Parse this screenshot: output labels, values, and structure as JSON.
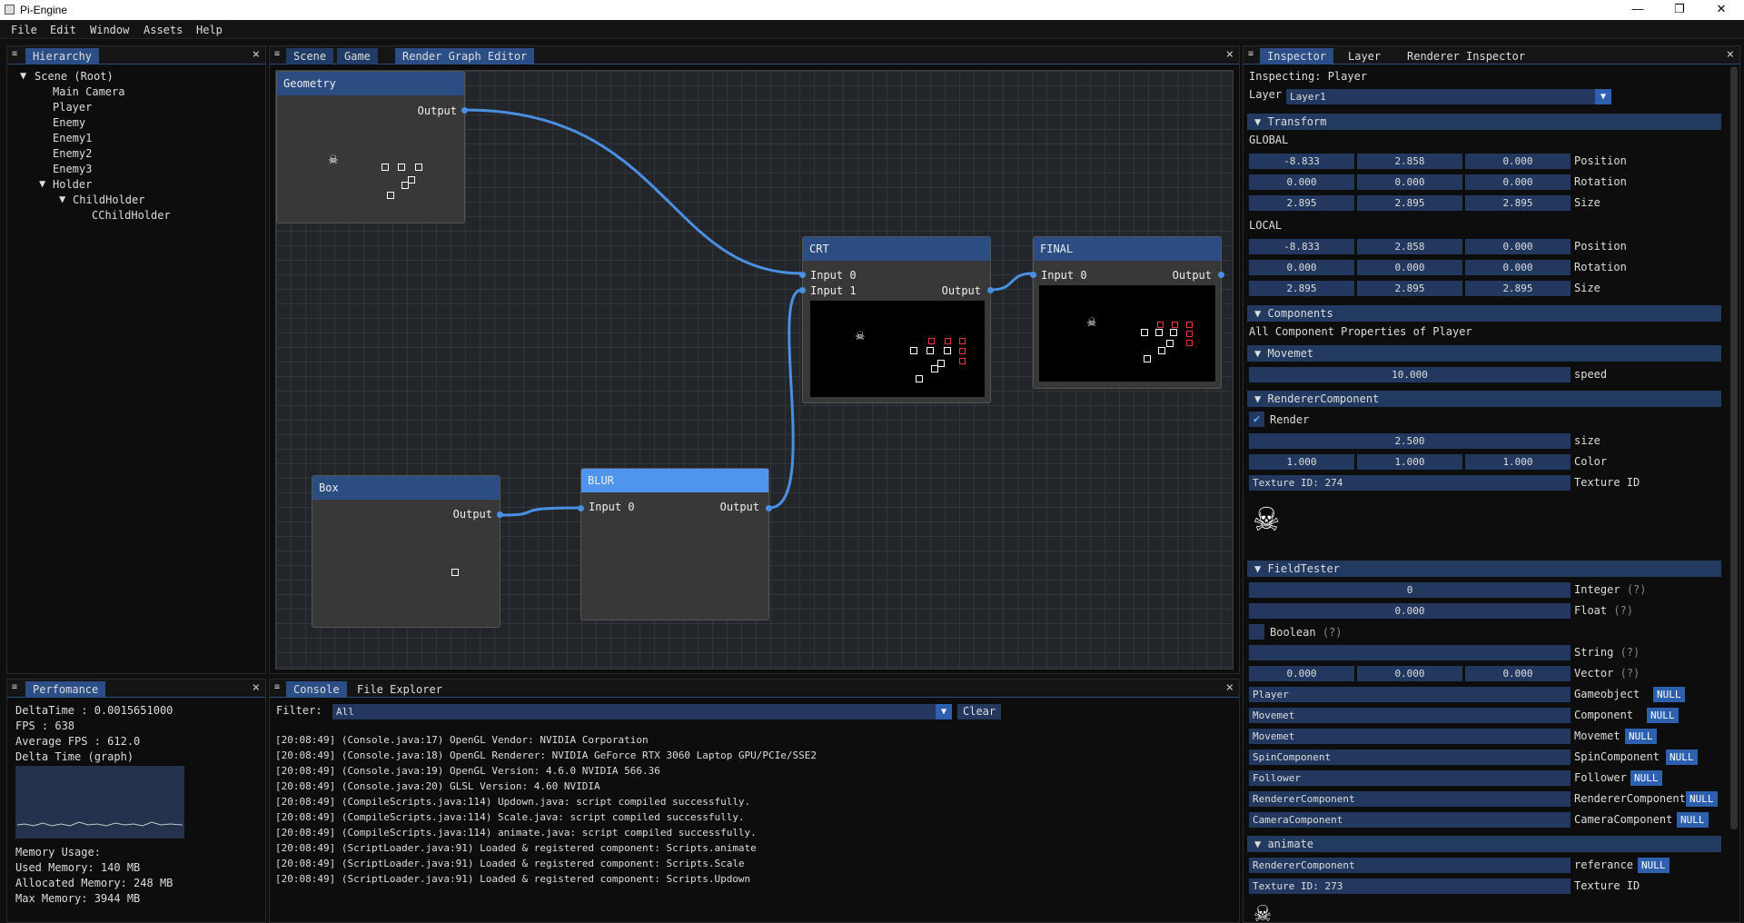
{
  "window": {
    "title": "Pi-Engine",
    "minimize": "—",
    "maximize": "❐",
    "close": "✕"
  },
  "menu": [
    "File",
    "Edit",
    "Window",
    "Assets",
    "Help"
  ],
  "hierarchy": {
    "tab": "Hierarchy",
    "items": [
      "Scene (Root)",
      "Main Camera",
      "Player",
      "Enemy",
      "Enemy1",
      "Enemy2",
      "Enemy3",
      "Holder",
      "ChildHolder",
      "CChildHolder"
    ]
  },
  "center_tabs": [
    "Scene",
    "Game",
    "Render Graph Editor"
  ],
  "graph": {
    "nodes": {
      "geometry": {
        "title": "Geometry",
        "out": "Output"
      },
      "crt": {
        "title": "CRT",
        "in0": "Input 0",
        "in1": "Input 1",
        "out": "Output"
      },
      "final": {
        "title": "FINAL",
        "in0": "Input 0",
        "out": "Output"
      },
      "box": {
        "title": "Box",
        "out": "Output"
      },
      "blur": {
        "title": "BLUR",
        "in0": "Input 0",
        "out": "Output"
      }
    }
  },
  "perf": {
    "tab": "Perfomance",
    "lines": [
      "DeltaTime : 0.0015651000",
      "FPS : 638",
      "Average FPS : 612.0",
      "Delta Time (graph)"
    ],
    "mem": [
      "Memory Usage:",
      "Used Memory: 140 MB",
      "Allocated Memory: 248 MB",
      "Max Memory: 3944 MB"
    ]
  },
  "console": {
    "tabs": [
      "Console",
      "File Explorer"
    ],
    "filter_label": "Filter:",
    "filter_value": "All",
    "clear": "Clear",
    "lines": [
      "[20:08:49] (Console.java:17) OpenGL Vendor: NVIDIA Corporation",
      "[20:08:49] (Console.java:18) OpenGL Renderer: NVIDIA GeForce RTX 3060 Laptop GPU/PCIe/SSE2",
      "[20:08:49] (Console.java:19) OpenGL Version: 4.6.0 NVIDIA 566.36",
      "[20:08:49] (Console.java:20) GLSL Version: 4.60 NVIDIA",
      "[20:08:49] (CompileScripts.java:114) Updown.java: script compiled successfully.",
      "[20:08:49] (CompileScripts.java:114) Scale.java: script compiled successfully.",
      "[20:08:49] (CompileScripts.java:114) animate.java: script compiled successfully.",
      "[20:08:49] (ScriptLoader.java:91) Loaded & registered component: Scripts.animate",
      "[20:08:49] (ScriptLoader.java:91) Loaded & registered component: Scripts.Scale",
      "[20:08:49] (ScriptLoader.java:91) Loaded & registered component: Scripts.Updown"
    ]
  },
  "inspector": {
    "tabs": [
      "Inspector",
      "Layer",
      "Renderer Inspector"
    ],
    "inspecting": "Inspecting: Player",
    "layer_label": "Layer",
    "layer_value": "Layer1",
    "transform": "Transform",
    "global": "GLOBAL",
    "local": "LOCAL",
    "g_pos": [
      "-8.833",
      "2.858",
      "0.000"
    ],
    "g_rot": [
      "0.000",
      "0.000",
      "0.000"
    ],
    "g_size": [
      "2.895",
      "2.895",
      "2.895"
    ],
    "l_pos": [
      "-8.833",
      "2.858",
      "0.000"
    ],
    "l_rot": [
      "0.000",
      "0.000",
      "0.000"
    ],
    "l_size": [
      "2.895",
      "2.895",
      "2.895"
    ],
    "position": "Position",
    "rotation": "Rotation",
    "size": "Size",
    "components": "Components",
    "all_props": "All Component Properties of Player",
    "movemet": "Movemet",
    "speed_value": "10.000",
    "speed": "speed",
    "renderer": "RendererComponent",
    "render": "Render",
    "size_value": "2.500",
    "size_lbl": "size",
    "color": [
      "1.000",
      "1.000",
      "1.000"
    ],
    "color_lbl": "Color",
    "texture_id": "Texture ID: 274",
    "texture_lbl": "Texture ID",
    "fieldtester": "FieldTester",
    "int_value": "0",
    "int_lbl": "Integer",
    "float_value": "0.000",
    "float_lbl": "Float",
    "bool_lbl": "Boolean",
    "string_lbl": "String",
    "vector": [
      "0.000",
      "0.000",
      "0.000"
    ],
    "vector_lbl": "Vector",
    "help": "(?)",
    "refs": [
      {
        "value": "Player",
        "label": "Gameobject"
      },
      {
        "value": "Movemet",
        "label": "Component"
      },
      {
        "value": "Movemet",
        "label": "Movemet"
      },
      {
        "value": "SpinComponent",
        "label": "SpinComponent"
      },
      {
        "value": "Follower",
        "label": "Follower"
      },
      {
        "value": "RendererComponent",
        "label": "RendererComponent"
      },
      {
        "value": "CameraComponent",
        "label": "CameraComponent"
      }
    ],
    "null": "NULL",
    "animate": "animate",
    "anim_ref_value": "RendererComponent",
    "anim_ref_lbl": "referance",
    "anim_tex": "Texture ID: 273",
    "anim_tex_lbl": "Texture ID"
  }
}
